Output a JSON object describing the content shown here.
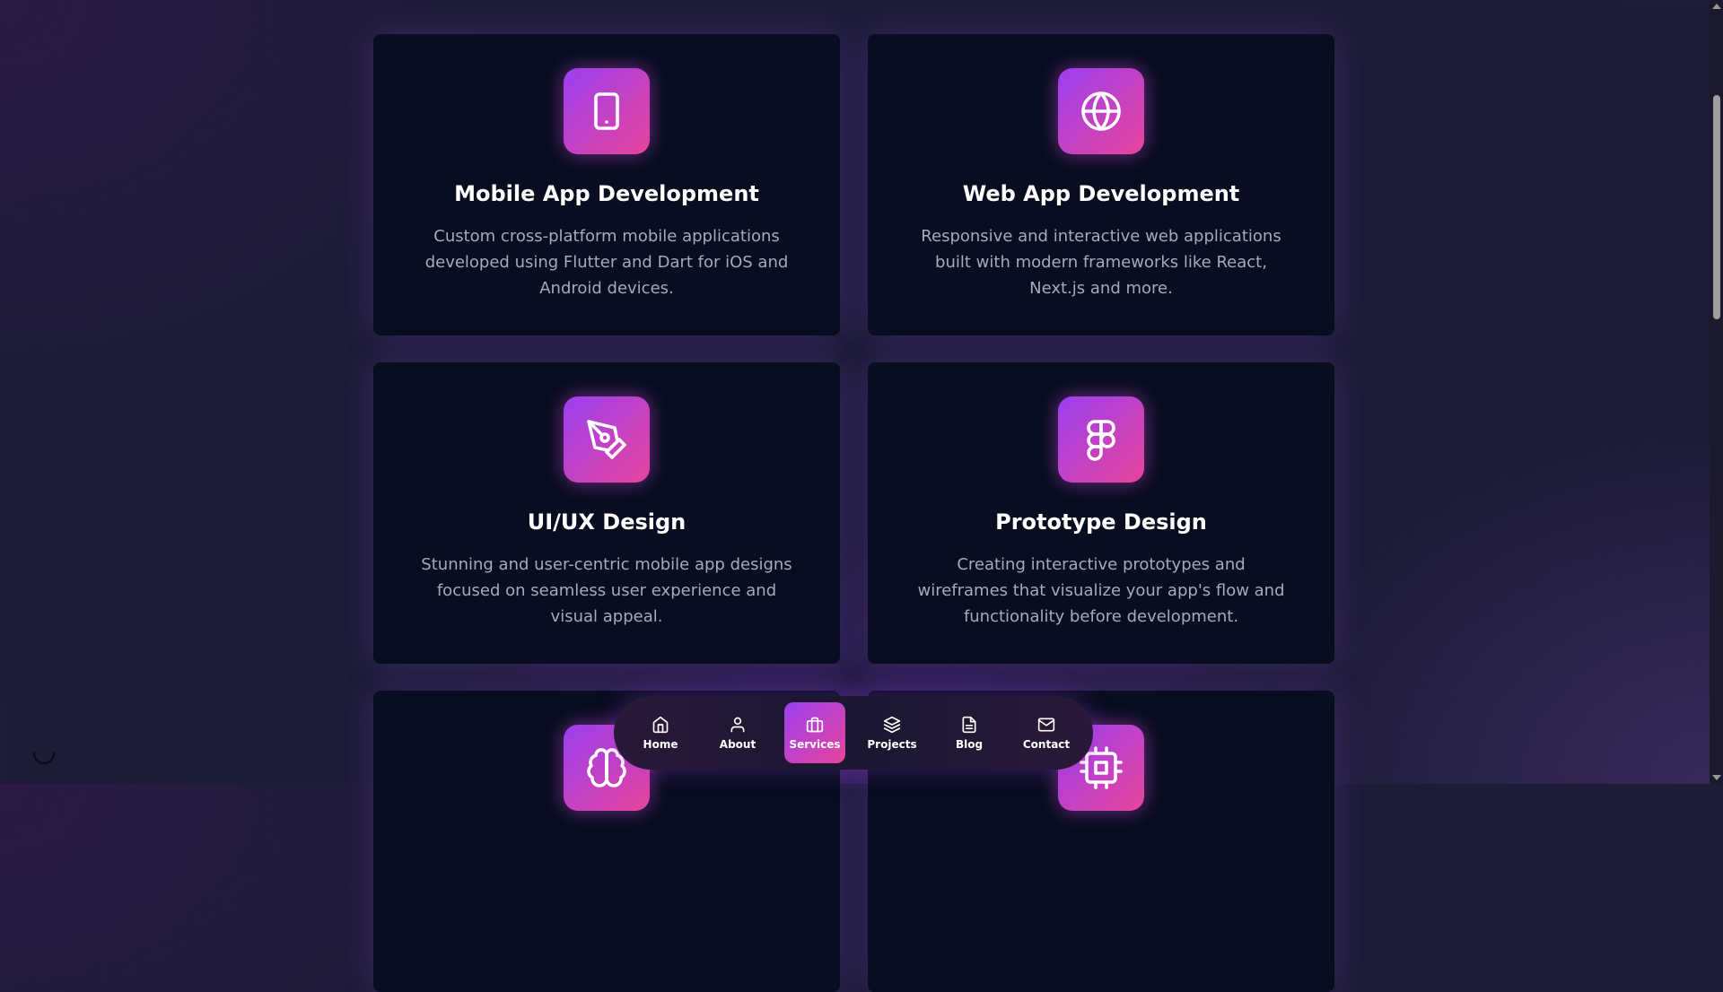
{
  "services": [
    {
      "title": "Mobile App Development",
      "description": "Custom cross-platform mobile applications developed using Flutter and Dart for iOS and Android devices.",
      "icon": "tablet-icon"
    },
    {
      "title": "Web App Development",
      "description": "Responsive and interactive web applications built with modern frameworks like React, Next.js and more.",
      "icon": "globe-icon"
    },
    {
      "title": "UI/UX Design",
      "description": "Stunning and user-centric mobile app designs focused on seamless user experience and visual appeal.",
      "icon": "pen-tool-icon"
    },
    {
      "title": "Prototype Design",
      "description": "Creating interactive prototypes and wireframes that visualize your app's flow and functionality before development.",
      "icon": "figma-icon"
    },
    {
      "icon": "brain-icon"
    },
    {
      "icon": "cpu-icon"
    }
  ],
  "nav": {
    "items": [
      {
        "label": "Home",
        "icon": "home-icon"
      },
      {
        "label": "About",
        "icon": "user-icon"
      },
      {
        "label": "Services",
        "icon": "briefcase-icon",
        "active": true
      },
      {
        "label": "Projects",
        "icon": "layers-icon"
      },
      {
        "label": "Blog",
        "icon": "file-text-icon"
      },
      {
        "label": "Contact",
        "icon": "mail-icon"
      }
    ]
  },
  "colors": {
    "accent_start": "#9b3ff0",
    "accent_end": "#e8449a",
    "card_background": "#080d1f",
    "page_background": "#1c1c36",
    "description_text": "#a4abbd"
  }
}
